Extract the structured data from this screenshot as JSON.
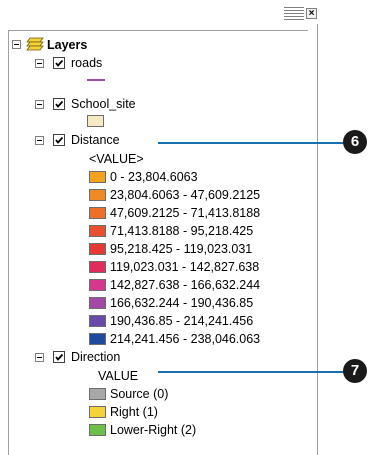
{
  "panel": {
    "close_label": "×"
  },
  "root": {
    "label": "Layers"
  },
  "layers": {
    "roads": {
      "label": "roads",
      "color": "#9b4fa8"
    },
    "school_site": {
      "label": "School_site",
      "color": "#f6e9c3"
    },
    "distance": {
      "label": "Distance",
      "field": "<VALUE>",
      "classes": [
        {
          "label": "0 - 23,804.6063",
          "color": "#f2a21e"
        },
        {
          "label": "23,804.6063 - 47,609.2125",
          "color": "#f08a25"
        },
        {
          "label": "47,609.2125 - 71,413.8188",
          "color": "#ed6f2a"
        },
        {
          "label": "71,413.8188 - 95,218.425",
          "color": "#e8512f"
        },
        {
          "label": "95,218.425 - 119,023.031",
          "color": "#e33a38"
        },
        {
          "label": "119,023.031 - 142,827.638",
          "color": "#e12d5b"
        },
        {
          "label": "142,827.638 - 166,632.244",
          "color": "#d7368e"
        },
        {
          "label": "166,632.244 - 190,436.85",
          "color": "#a448a8"
        },
        {
          "label": "190,436.85 - 214,241.456",
          "color": "#6a4aa9"
        },
        {
          "label": "214,241.456 - 238,046.063",
          "color": "#1f4aa0"
        }
      ]
    },
    "direction": {
      "label": "Direction",
      "field": "VALUE",
      "classes": [
        {
          "label": "Source (0)",
          "color": "#a8a8a8"
        },
        {
          "label": "Right (1)",
          "color": "#f5d23a"
        },
        {
          "label": "Lower-Right (2)",
          "color": "#6cc04a"
        }
      ]
    }
  },
  "callouts": [
    {
      "number": "6",
      "color": "#1a6fb0"
    },
    {
      "number": "7",
      "color": "#1a6fb0"
    }
  ]
}
